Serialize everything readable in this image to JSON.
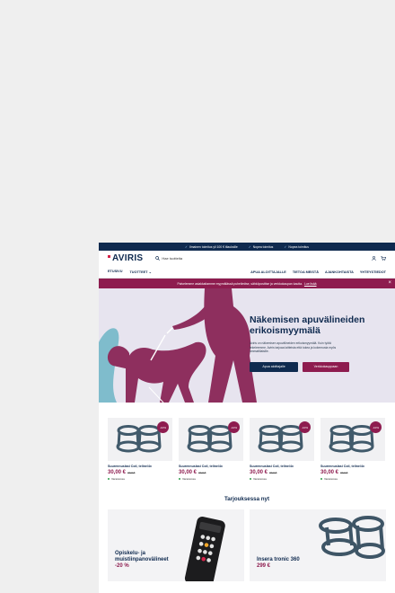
{
  "topbar": {
    "items": [
      "Ilmainen toimitus yli 100 € tilauksille",
      "Nopea toimitus",
      "Nopea toimitus"
    ]
  },
  "header": {
    "logo": "AVIRIS",
    "search_placeholder": "Hae tuotteita",
    "icons": [
      "user-icon",
      "cart-icon"
    ]
  },
  "nav": {
    "left": [
      "ETUSIVU",
      "TUOTTEET"
    ],
    "right": [
      "APUA ALOITTAJALLE",
      "TIETOA MEISTÄ",
      "AJANKOHTAISTA",
      "YHTEYSTIEDOT"
    ]
  },
  "notice": {
    "text": "Palvelemme asiakkaitamme myymälässä puhelimitse, sähköpostitse ja verkkokaupan kautta.",
    "link": "Lue lisää",
    "close": "×"
  },
  "hero": {
    "title_line1": "Näkemisen apuvälineiden",
    "title_line2": "erikoismyymälä",
    "body": "Aviris on näkemisen apuvälineiden erikoismyymälä. Kuin työtä tekeleemme. Aviris tarjoaa laitteista että tukea ja kokemusta myös ammattilaisille.",
    "btn_primary": "Apua aloittajalle",
    "btn_secondary": "Verkkokauppaan"
  },
  "products": [
    {
      "badge": "-10%",
      "name": "Suurennuslasi Coil, teline/4x",
      "price": "30,00 €",
      "old_price": "33,0 €",
      "stock": "Varastossa"
    },
    {
      "badge": "-10%",
      "name": "Suurennuslasi Coil, teline/4x",
      "price": "30,00 €",
      "old_price": "33,0 €",
      "stock": "Varastossa"
    },
    {
      "badge": "-10%",
      "name": "Suurennuslasi Coil, teline/4x",
      "price": "30,00 €",
      "old_price": "33,0 €",
      "stock": "Varastossa"
    },
    {
      "badge": "-10%",
      "name": "Suurennuslasi Coil, teline/4x",
      "price": "30,00 €",
      "old_price": "33,0 €",
      "stock": "Varastossa"
    }
  ],
  "offers_title": "Tarjouksessa nyt",
  "offers": [
    {
      "line1": "Opiskelu- ja",
      "line2": "muistiinpanovälineet",
      "price": "-20 %"
    },
    {
      "line1": "Insera tronic 360",
      "line2": "",
      "price": "299 €"
    }
  ],
  "colors": {
    "navy": "#0f2a4f",
    "wine": "#8e1c4f",
    "hero_bg": "#e7e4ef"
  }
}
